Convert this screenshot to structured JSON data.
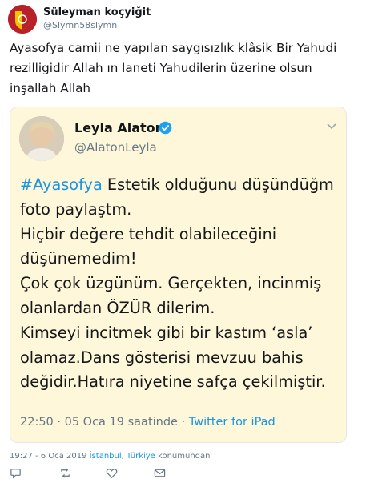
{
  "tweet": {
    "author_name": "Süleyman koçyiğit",
    "author_handle": "@Slymn58slymn",
    "text": "Ayasofya camii ne yapılan saygısızlık klâsik Bir Yahudi rezilligidir Allah ın laneti Yahudilerin üzerine olsun inşallah Allah",
    "timestamp": "19:27 - 6 Oca 2019",
    "location_link": "İstanbul, Türkiye",
    "location_suffix": " konumundan"
  },
  "quoted": {
    "author_name": "Leyla Alaton",
    "author_handle": "@AlatonLeyla",
    "hashtag": "#Ayasofya",
    "text_after_hashtag": " Estetik olduğunu düşündüğm foto paylaştm.\nHiçbir değere tehdit olabileceğini düşünemedim!\nÇok çok üzgünüm. Gerçekten, incinmiş olanlardan ÖZÜR dilerim.\nKimseyi incitmek gibi bir kastım ‘asla’ olamaz.Dans gösterisi mevzuu bahis değidir.Hatıra niyetine safça çekilmiştir.",
    "meta_time": "22:50 · 05 Oca 19 saatinde · ",
    "meta_app": "Twitter for iPad"
  },
  "colors": {
    "link": "#1b95e0",
    "quote_bg": "#fff7d9",
    "muted": "#657786"
  },
  "icons": [
    "galatasaray-logo-avatar",
    "verified-badge-icon",
    "chevron-down-icon",
    "reply-icon",
    "retweet-icon",
    "like-icon",
    "message-icon"
  ]
}
